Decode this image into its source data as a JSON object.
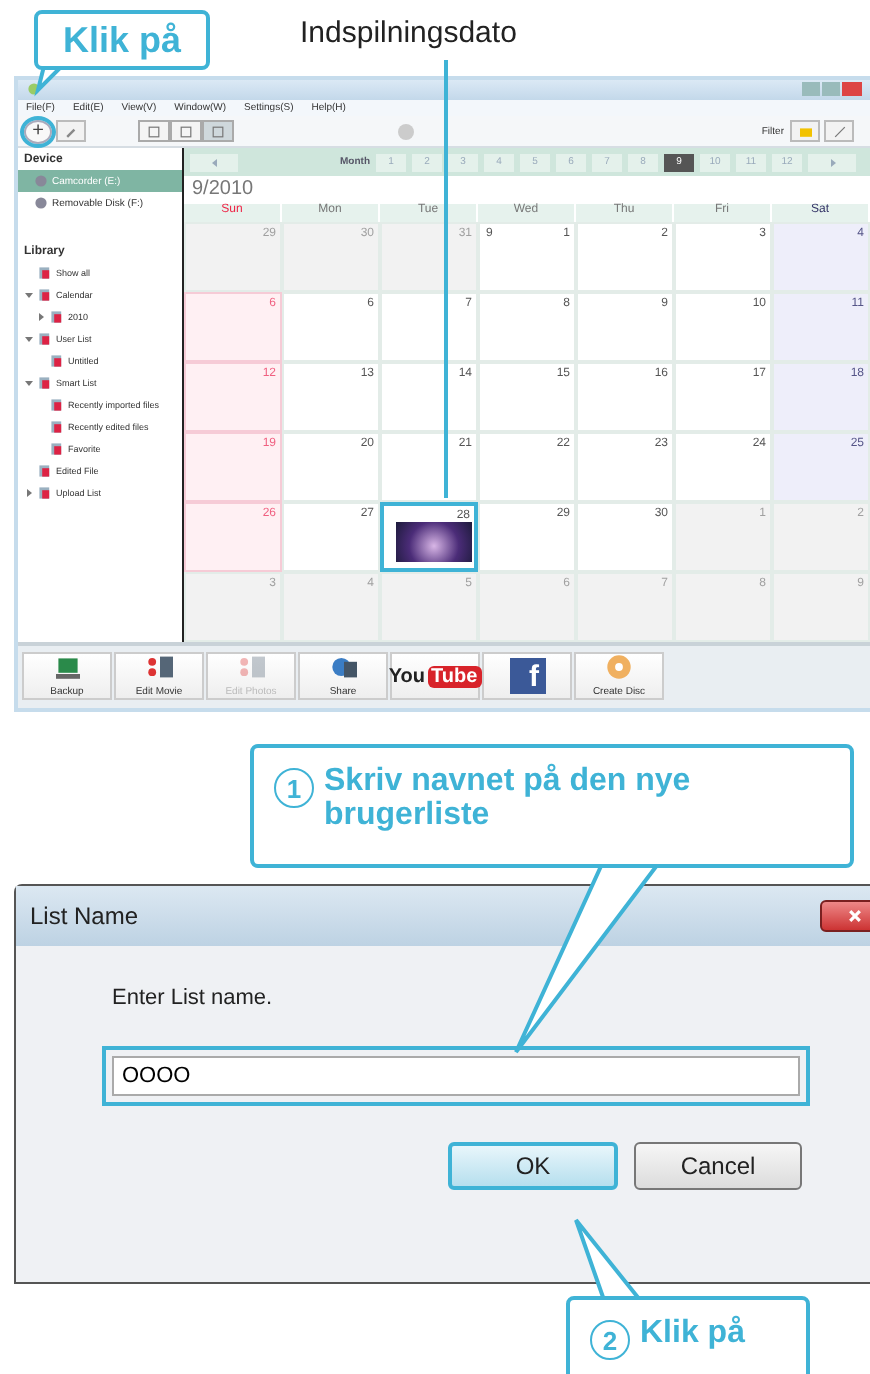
{
  "top_callout": {
    "text": "Klik på"
  },
  "date_label": "Indspilningsdato",
  "app": {
    "menu": [
      "File(F)",
      "Edit(E)",
      "View(V)",
      "Window(W)",
      "Settings(S)",
      "Help(H)"
    ],
    "add_button": {
      "label": "+",
      "highlighted": true
    },
    "view_modes": [
      {
        "selected": false
      },
      {
        "selected": false
      },
      {
        "selected": true
      }
    ],
    "filter_label": "Filter",
    "sidebar": {
      "device_heading": "Device",
      "devices": [
        {
          "label": "Camcorder (E:)",
          "selected": true
        },
        {
          "label": "Removable Disk (F:)",
          "selected": false
        }
      ],
      "library_heading": "Library",
      "library": [
        {
          "label": "Show all"
        },
        {
          "label": "Calendar",
          "expanded": true,
          "children": [
            {
              "label": "2010",
              "expanded": false
            }
          ]
        },
        {
          "label": "User List",
          "expanded": true,
          "children": [
            {
              "label": "Untitled"
            }
          ]
        },
        {
          "label": "Smart List",
          "expanded": true,
          "children": [
            {
              "label": "Recently imported files"
            },
            {
              "label": "Recently edited files"
            },
            {
              "label": "Favorite"
            }
          ]
        },
        {
          "label": "Edited File"
        },
        {
          "label": "Upload List",
          "expanded": false
        }
      ]
    },
    "month_label": "Month",
    "months": [
      {
        "label": "1",
        "selected": false
      },
      {
        "label": "2",
        "selected": false
      },
      {
        "label": "3",
        "selected": false
      },
      {
        "label": "4",
        "selected": false
      },
      {
        "label": "5",
        "selected": false
      },
      {
        "label": "6",
        "selected": false
      },
      {
        "label": "7",
        "selected": false
      },
      {
        "label": "8",
        "selected": false
      },
      {
        "label": "9",
        "selected": true
      },
      {
        "label": "10",
        "selected": false
      },
      {
        "label": "11",
        "selected": false
      },
      {
        "label": "12",
        "selected": false
      }
    ],
    "calendar_title": "9/2010",
    "weekdays": [
      "Sun",
      "Mon",
      "Tue",
      "Wed",
      "Thu",
      "Fri",
      "Sat"
    ],
    "weeks": [
      [
        {
          "day": "29",
          "muted": true
        },
        {
          "day": "30",
          "muted": true
        },
        {
          "day": "31",
          "muted": true
        },
        {
          "day": "1",
          "muted": false,
          "month_marker": "9"
        },
        {
          "day": "2",
          "muted": false
        },
        {
          "day": "3",
          "muted": false
        },
        {
          "day": "4",
          "muted": false
        }
      ],
      [
        {
          "day": "6",
          "muted": false
        },
        {
          "day": "6",
          "muted": false
        },
        {
          "day": "7",
          "muted": false
        },
        {
          "day": "8",
          "muted": false
        },
        {
          "day": "9",
          "muted": false
        },
        {
          "day": "10",
          "muted": false
        },
        {
          "day": "11",
          "muted": false
        }
      ],
      [
        {
          "day": "12",
          "muted": false
        },
        {
          "day": "13",
          "muted": false
        },
        {
          "day": "14",
          "muted": false
        },
        {
          "day": "15",
          "muted": false
        },
        {
          "day": "16",
          "muted": false
        },
        {
          "day": "17",
          "muted": false
        },
        {
          "day": "18",
          "muted": false
        }
      ],
      [
        {
          "day": "19",
          "muted": false
        },
        {
          "day": "20",
          "muted": false
        },
        {
          "day": "21",
          "muted": false
        },
        {
          "day": "22",
          "muted": false
        },
        {
          "day": "23",
          "muted": false
        },
        {
          "day": "24",
          "muted": false
        },
        {
          "day": "25",
          "muted": false
        }
      ],
      [
        {
          "day": "26",
          "muted": false
        },
        {
          "day": "27",
          "muted": false
        },
        {
          "day": "28",
          "muted": false,
          "has_photo": true,
          "highlighted": true
        },
        {
          "day": "29",
          "muted": false
        },
        {
          "day": "30",
          "muted": false
        },
        {
          "day": "1",
          "muted": true
        },
        {
          "day": "2",
          "muted": true
        }
      ],
      [
        {
          "day": "3",
          "muted": true
        },
        {
          "day": "4",
          "muted": true
        },
        {
          "day": "5",
          "muted": true
        },
        {
          "day": "6",
          "muted": true
        },
        {
          "day": "7",
          "muted": true
        },
        {
          "day": "8",
          "muted": true
        },
        {
          "day": "9",
          "muted": true
        }
      ]
    ],
    "tools": [
      {
        "kind": "backup",
        "label": "Backup",
        "disabled": false
      },
      {
        "kind": "edit",
        "label": "Edit Movie",
        "disabled": false
      },
      {
        "kind": "edit",
        "label": "Edit Photos",
        "disabled": true
      },
      {
        "kind": "share",
        "label": "Share",
        "disabled": false
      },
      {
        "kind": "youtube",
        "parts": [
          "You",
          "Tube"
        ]
      },
      {
        "kind": "facebook",
        "parts": [
          "f"
        ]
      },
      {
        "kind": "disc",
        "label": "Create Disc",
        "disabled": false
      }
    ]
  },
  "step_callouts": [
    {
      "step": "1",
      "text": "Skriv navnet på den nye brugerliste"
    },
    {
      "step": "2",
      "text": "Klik på"
    }
  ],
  "dialog": {
    "title": "List Name",
    "prompt": "Enter List name.",
    "value": "OOOO",
    "field_highlighted": true,
    "buttons": [
      {
        "label": "OK",
        "default": true
      },
      {
        "label": "Cancel",
        "default": false
      }
    ]
  }
}
